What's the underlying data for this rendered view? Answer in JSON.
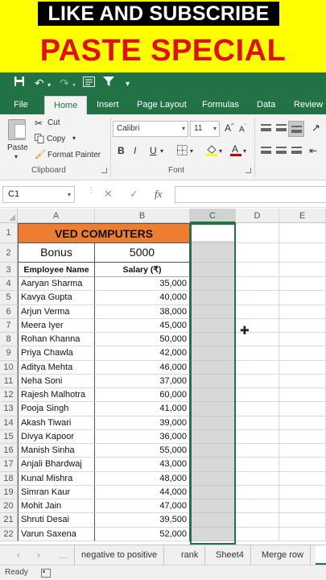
{
  "banner": {
    "top_text": "LIKE AND SUBSCRIBE",
    "title": "PASTE SPECIAL"
  },
  "qat": {
    "icons": [
      "save-icon",
      "undo-icon",
      "redo-icon",
      "form-icon",
      "filter-icon",
      "customize-icon"
    ]
  },
  "tabs": [
    "File",
    "Home",
    "Insert",
    "Page Layout",
    "Formulas",
    "Data",
    "Review"
  ],
  "active_tab": "Home",
  "ribbon": {
    "clipboard": {
      "paste": "Paste",
      "cut": "Cut",
      "copy": "Copy",
      "format_painter": "Format Painter",
      "label": "Clipboard"
    },
    "font": {
      "name": "Calibri",
      "size": "11",
      "bold": "B",
      "italic": "I",
      "underline": "U",
      "label": "Font"
    },
    "font_color": "#c00000",
    "fill_color": "#ffff00"
  },
  "formula_bar": {
    "name_box": "C1",
    "cancel": "✕",
    "enter": "✓",
    "fx": "fx",
    "content": ""
  },
  "columns": [
    "A",
    "B",
    "C",
    "D",
    "E"
  ],
  "sheet": {
    "title": "VED COMPUTERS",
    "bonus_label": "Bonus",
    "bonus_value": "5000",
    "header_name": "Employee Name",
    "header_salary": "Salary (₹)",
    "rows": [
      {
        "num": "4",
        "name": "Aaryan Sharma",
        "salary": "35,000"
      },
      {
        "num": "5",
        "name": "Kavya Gupta",
        "salary": "40,000"
      },
      {
        "num": "6",
        "name": "Arjun Verma",
        "salary": "38,000"
      },
      {
        "num": "7",
        "name": "Meera Iyer",
        "salary": "45,000"
      },
      {
        "num": "8",
        "name": "Rohan Khanna",
        "salary": "50,000"
      },
      {
        "num": "9",
        "name": "Priya Chawla",
        "salary": "42,000"
      },
      {
        "num": "10",
        "name": "Aditya Mehta",
        "salary": "46,000"
      },
      {
        "num": "11",
        "name": "Neha Soni",
        "salary": "37,000"
      },
      {
        "num": "12",
        "name": "Rajesh Malhotra",
        "salary": "60,000"
      },
      {
        "num": "13",
        "name": "Pooja Singh",
        "salary": "41,000"
      },
      {
        "num": "14",
        "name": "Akash Tiwari",
        "salary": "39,000"
      },
      {
        "num": "15",
        "name": "Divya Kapoor",
        "salary": "36,000"
      },
      {
        "num": "16",
        "name": "Manish Sinha",
        "salary": "55,000"
      },
      {
        "num": "17",
        "name": "Anjali Bhardwaj",
        "salary": "43,000"
      },
      {
        "num": "18",
        "name": "Kunal Mishra",
        "salary": "48,000"
      },
      {
        "num": "19",
        "name": "Simran Kaur",
        "salary": "44,000"
      },
      {
        "num": "20",
        "name": "Mohit Jain",
        "salary": "47,000"
      },
      {
        "num": "21",
        "name": "Shruti Desai",
        "salary": "39,500"
      },
      {
        "num": "22",
        "name": "Varun Saxena",
        "salary": "52,000"
      }
    ]
  },
  "sheet_tabs": [
    "negative to positive",
    "rank",
    "Sheet4",
    "Merge row"
  ],
  "status": {
    "ready": "Ready"
  }
}
